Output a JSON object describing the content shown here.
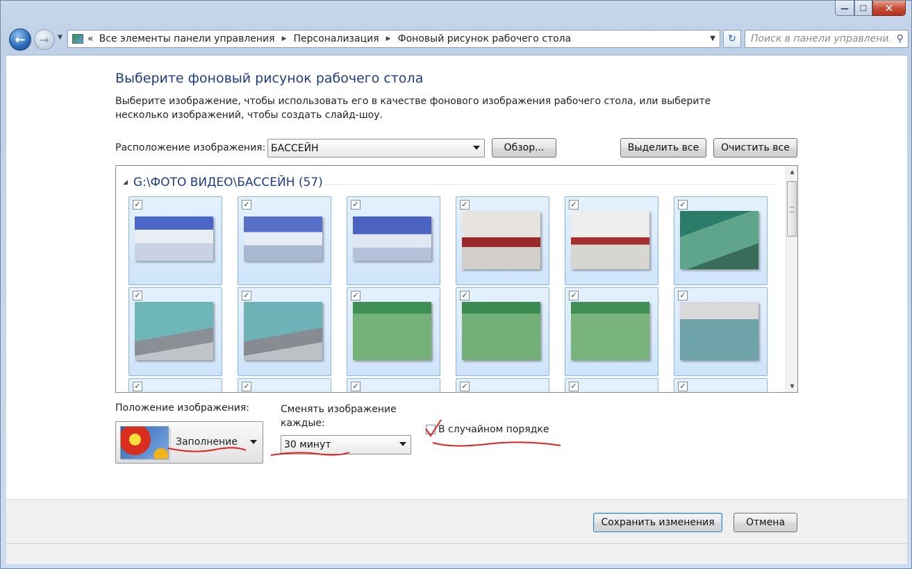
{
  "window": {
    "minimize_glyph": "—",
    "maximize_glyph": "☐",
    "close_glyph": "✕"
  },
  "navigation": {
    "back_glyph": "←",
    "forward_glyph": "→",
    "address": {
      "prefix_glyph": "«",
      "segments": [
        "Все элементы панели управления",
        "Персонализация",
        "Фоновый рисунок рабочего стола"
      ]
    },
    "refresh_glyph": "↻",
    "search_placeholder": "Поиск в панели управления"
  },
  "page": {
    "title": "Выберите фоновый рисунок рабочего стола",
    "description": "Выберите изображение, чтобы использовать его в качестве фонового изображения рабочего стола, или выберите несколько изображений, чтобы создать слайд-шоу.",
    "location_label": "Расположение изображения:",
    "location_value": "БАССЕЙН",
    "browse_label": "Обзор...",
    "select_all_label": "Выделить все",
    "clear_all_label": "Очистить все"
  },
  "gallery": {
    "group_title": "G:\\ФОТО ВИДЕО\\БАССЕЙН (57)",
    "check_glyph": "✓",
    "tiles": [
      {
        "scene": "pool-boys-sitting",
        "checked": true
      },
      {
        "scene": "pool-boys-standing",
        "checked": true
      },
      {
        "scene": "pool-boys-coach",
        "checked": true
      },
      {
        "scene": "lobby-person",
        "checked": true
      },
      {
        "scene": "lobby-hall",
        "checked": true
      },
      {
        "scene": "swimmers-lane",
        "checked": true
      },
      {
        "scene": "coach-poolside",
        "checked": true
      },
      {
        "scene": "coach-poolside-2",
        "checked": true
      },
      {
        "scene": "swimmers-green",
        "checked": true
      },
      {
        "scene": "swimmers-green-2",
        "checked": true
      },
      {
        "scene": "swimmers-green-3",
        "checked": true
      },
      {
        "scene": "swimmers-flag",
        "checked": true
      },
      {
        "scene": "partial",
        "checked": true
      },
      {
        "scene": "partial",
        "checked": true
      },
      {
        "scene": "partial",
        "checked": true
      },
      {
        "scene": "partial",
        "checked": true
      },
      {
        "scene": "partial",
        "checked": true
      },
      {
        "scene": "partial",
        "checked": true
      }
    ]
  },
  "options": {
    "position_label": "Положение изображения:",
    "position_value": "Заполнение",
    "interval_label": "Сменять изображение каждые:",
    "interval_value": "30 минут",
    "shuffle_label": "В случайном порядке",
    "shuffle_checked": false
  },
  "footer": {
    "save_label": "Сохранить изменения",
    "cancel_label": "Отмена"
  },
  "colors": {
    "accent_title": "#1e3b87",
    "annotation_red": "#e0201c"
  }
}
